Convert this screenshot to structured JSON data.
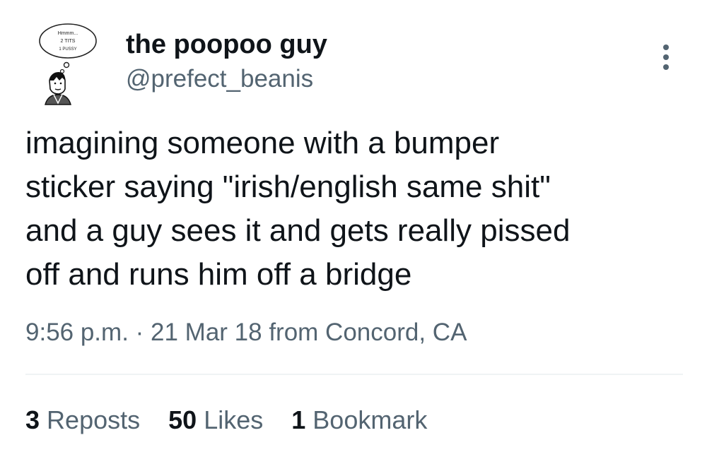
{
  "author": {
    "name": "the poopoo guy",
    "handle": "@prefect_beanis",
    "avatar": {
      "thought_bubble_lines": [
        "Hmmm...",
        "2 TITS",
        "1 PUSSY"
      ]
    }
  },
  "icons": {
    "more": "more-horizontal-dots-icon"
  },
  "tweet": {
    "text": "imagining someone with a bumper\nsticker saying \"irish/english same shit\"\nand a guy sees it and gets really pissed\noff and runs him off a bridge",
    "timestamp_line": "9:56 p.m. · 21 Mar 18 from Concord, CA"
  },
  "stats": [
    {
      "count": "3",
      "label": "Reposts"
    },
    {
      "count": "50",
      "label": "Likes"
    },
    {
      "count": "1",
      "label": "Bookmark"
    }
  ],
  "colors": {
    "primary_text": "#0f1419",
    "secondary_text": "#536471",
    "divider": "#eff3f4",
    "background": "#ffffff"
  }
}
